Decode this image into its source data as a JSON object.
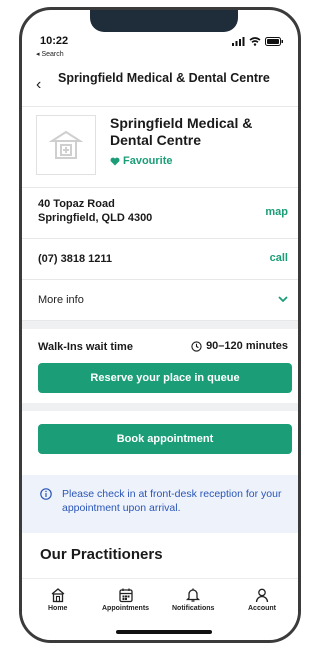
{
  "status_bar": {
    "time": "10:22",
    "back_app": "◂ Search"
  },
  "nav": {
    "title": "Springfield Medical & Dental Centre"
  },
  "clinic": {
    "name": "Springfield Medical & Dental Centre",
    "favourite_label": "Favourite"
  },
  "address": {
    "line1": "40 Topaz Road",
    "line2": "Springfield, QLD 4300",
    "action": "map"
  },
  "phone": {
    "number": "(07) 3818 1211",
    "action": "call"
  },
  "more_info": {
    "label": "More info"
  },
  "walk_in": {
    "label": "Walk-Ins wait time",
    "wait": "90–120 minutes",
    "reserve_button": "Reserve your place in queue"
  },
  "booking": {
    "button": "Book appointment"
  },
  "notice": {
    "text": "Please check in at front-desk reception for your appointment upon arrival."
  },
  "practitioners": {
    "title": "Our Practitioners"
  },
  "tabs": [
    {
      "label": "Home",
      "icon": "home-icon"
    },
    {
      "label": "Appointments",
      "icon": "calendar-icon"
    },
    {
      "label": "Notifications",
      "icon": "bell-icon"
    },
    {
      "label": "Account",
      "icon": "user-icon"
    }
  ],
  "colors": {
    "accent": "#1b9e77",
    "info": "#2a55b6",
    "band": "#eef0f2"
  }
}
